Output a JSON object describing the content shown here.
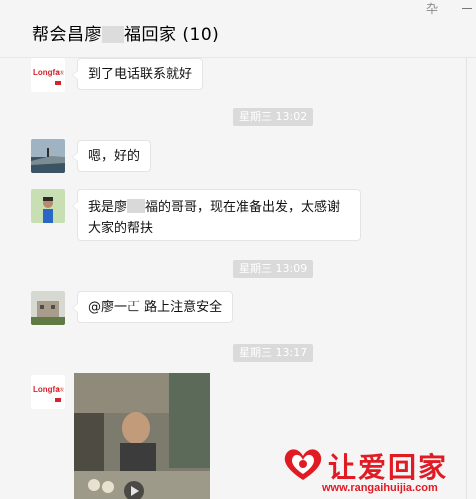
{
  "window": {
    "title": "帮会昌廖",
    "title_suffix": "福回家 (10)",
    "pin_glyph": "卆"
  },
  "messages": [
    {
      "text": "到了电话联系就好",
      "avatar": "longfa-logo"
    },
    {
      "text": "嗯，好的",
      "avatar": "seaside-photo"
    },
    {
      "text_before": "我是廖",
      "text_after": "福的哥哥，现在准备出发，太感谢",
      "line2": "大家的帮扶",
      "avatar": "person-photo"
    },
    {
      "text": "@廖一𠀀 路上注意安全",
      "avatar": "building-photo"
    }
  ],
  "timestamps": [
    "星期三 13:02",
    "星期三 13:09",
    "星期三 13:17"
  ],
  "logo": {
    "brand": "Longfa",
    "small": "龙发"
  },
  "watermark": {
    "name": "让爱回家",
    "url": "www.rangaihuijia.com"
  },
  "colors": {
    "background": "#f5f5f5",
    "bubble": "#ffffff",
    "timestamp_bg": "#dadada",
    "watermark": "#e01b23"
  }
}
